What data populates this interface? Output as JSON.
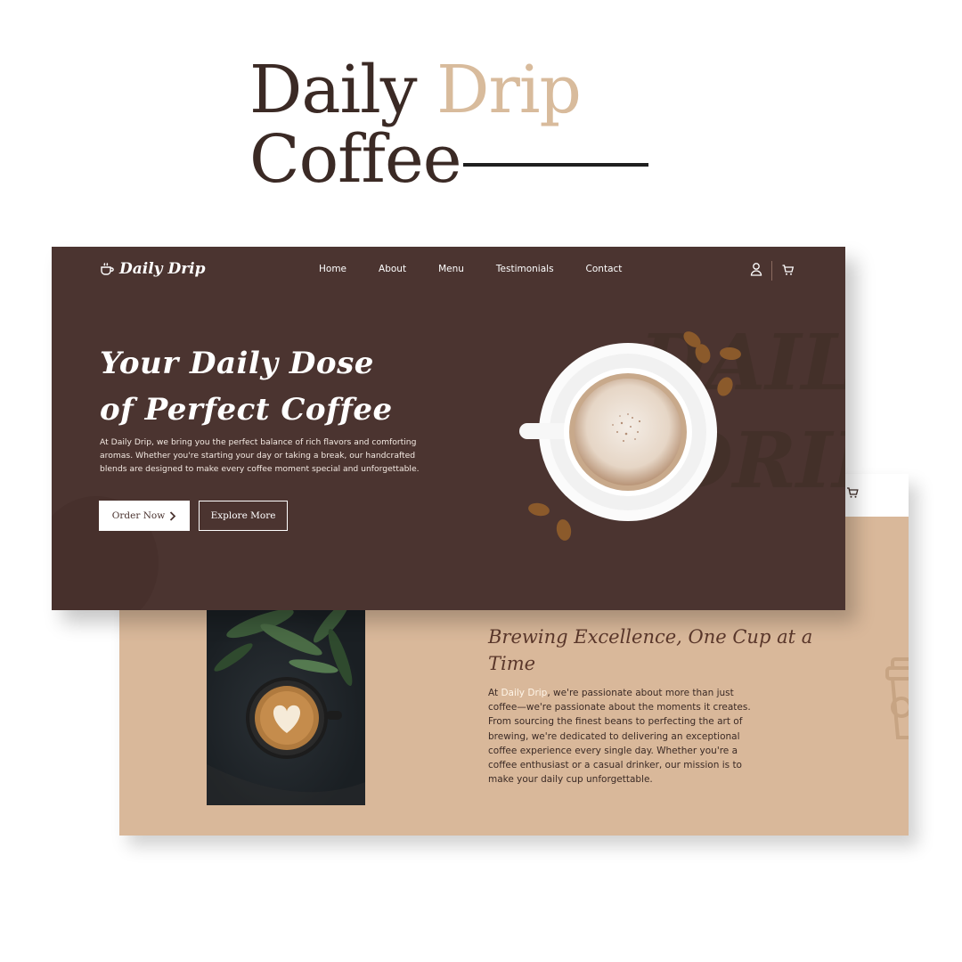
{
  "showcase": {
    "title_part1": "Daily",
    "title_part2": "Drip",
    "title_line2": "Coffee"
  },
  "header": {
    "logo_text": "Daily Drip",
    "nav": [
      "Home",
      "About",
      "Menu",
      "Testimonials",
      "Contact"
    ],
    "icons": [
      "user-icon",
      "cart-icon"
    ]
  },
  "hero": {
    "title_line1": "Your Daily Dose",
    "title_line2": "of Perfect Coffee",
    "description": "At Daily Drip, we bring you the perfect balance of rich flavors and comforting aromas. Whether you're starting your day or taking a break, our handcrafted blends are designed to make every coffee moment special and unforgettable.",
    "order_button": "Order Now",
    "explore_button": "Explore More",
    "watermark_line1": "DAILY",
    "watermark_line2": "DRIP"
  },
  "about": {
    "title": "Brewing Excellence, One Cup at a Time",
    "text_prefix": "At ",
    "text_highlight": "Daily Drip",
    "text_rest": ", we're passionate about more than just coffee—we're passionate about the moments it creates. From sourcing the finest beans to perfecting the art of brewing, we're dedicated to delivering an exceptional coffee experience every single day. Whether you're a coffee enthusiast or a casual drinker, our mission is to make your daily cup unforgettable."
  },
  "colors": {
    "hero_bg": "#4b3430",
    "about_bg": "#d9b89a",
    "accent": "#d8bb9c",
    "dark_text": "#3b2a25"
  }
}
